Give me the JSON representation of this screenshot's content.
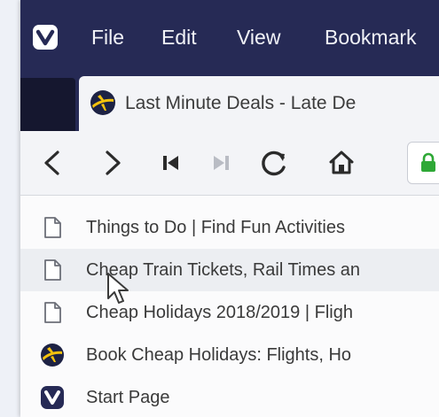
{
  "menubar": {
    "items": [
      "File",
      "Edit",
      "View",
      "Bookmark"
    ]
  },
  "tab": {
    "title": "Last Minute Deals - Late De",
    "icon": "plane-globe-icon"
  },
  "navbar": {
    "icons": [
      "back-icon",
      "forward-icon",
      "skip-back-icon",
      "skip-forward-icon",
      "reload-icon",
      "home-icon",
      "lock-icon"
    ]
  },
  "history": {
    "items": [
      {
        "label": "Things to Do | Find Fun Activities",
        "icon": "page-icon"
      },
      {
        "label": "Cheap Train Tickets, Rail Times an",
        "icon": "page-icon"
      },
      {
        "label": "Cheap Holidays 2018/2019 | Fligh",
        "icon": "page-icon"
      },
      {
        "label": "Book Cheap Holidays: Flights, Ho",
        "icon": "plane-globe-icon"
      },
      {
        "label": "Start Page",
        "icon": "vivaldi-icon"
      }
    ]
  },
  "colors": {
    "menubar": "#262a55",
    "tab_dark": "#15172f",
    "toolbar": "#f3f4f7",
    "lock": "#2ea836",
    "globe_yellow": "#f4c20d",
    "globe_navy": "#1d2244"
  }
}
